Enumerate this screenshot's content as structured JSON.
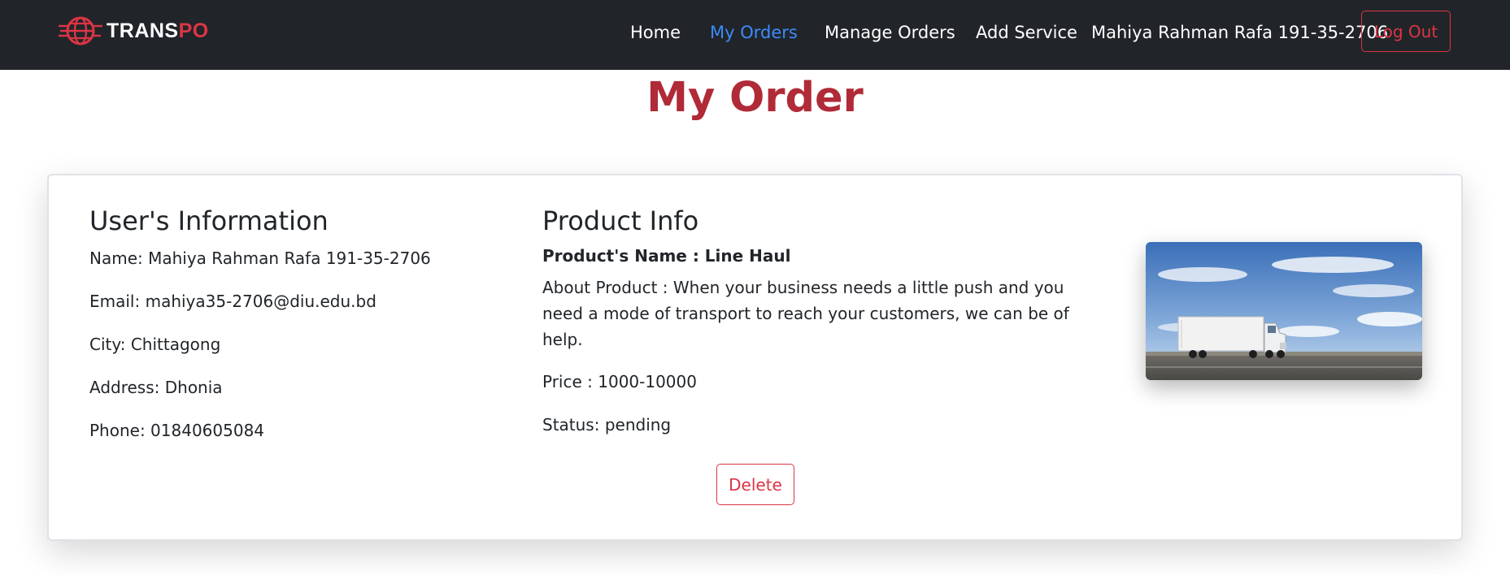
{
  "brand": {
    "name_part1": "TRANS",
    "name_part2": "PO",
    "logo_icon": "globe-truck-logo-icon",
    "accent_color": "#dc3545"
  },
  "nav": {
    "items": [
      {
        "label": "Home",
        "active": false
      },
      {
        "label": "My Orders",
        "active": true
      },
      {
        "label": "Manage Orders",
        "active": false
      },
      {
        "label": "Add Service",
        "active": false
      }
    ],
    "user_name": "Mahiya Rahman Rafa 191-35-2706",
    "logout_label": "Log Out",
    "active_color": "#3d8bfd",
    "background_color": "#212529"
  },
  "page": {
    "title": "My Order",
    "title_color": "#b02a37"
  },
  "order": {
    "user": {
      "heading": "User's Information",
      "name": "Name: Mahiya Rahman Rafa 191-35-2706",
      "email": "Email: mahiya35-2706@diu.edu.bd",
      "city": "City: Chittagong",
      "address": "Address: Dhonia",
      "phone": "Phone: 01840605084"
    },
    "product": {
      "heading": "Product Info",
      "name": "Product's Name : Line Haul",
      "about": "About Product : When your business needs a little push and you need a mode of transport to reach your customers, we can be of help.",
      "price": "Price : 1000-10000",
      "status": "Status: pending",
      "image_icon": "truck-on-road-image"
    },
    "delete_label": "Delete"
  }
}
